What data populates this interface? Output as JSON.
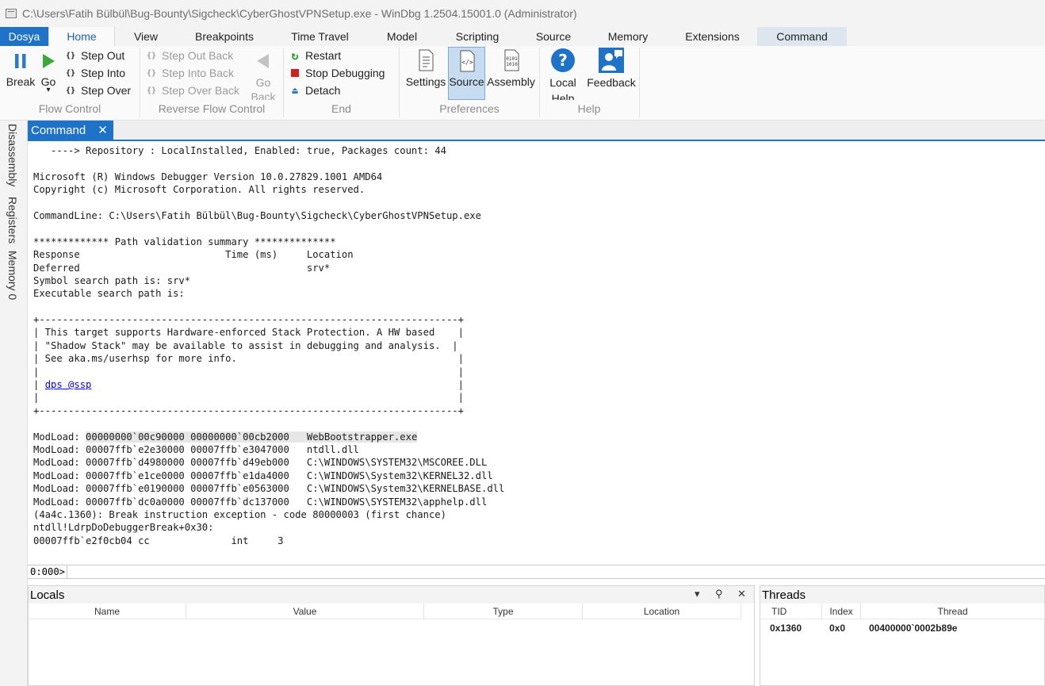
{
  "window": {
    "title": "C:\\Users\\Fatih Bülbül\\Bug-Bounty\\Sigcheck\\CyberGhostVPNSetup.exe  - WinDbg 1.2504.15001.0 (Administrator)"
  },
  "ribbon_tabs": [
    "Dosya",
    "Home",
    "View",
    "Breakpoints",
    "Time Travel",
    "Model",
    "Scripting",
    "Source",
    "Memory",
    "Extensions",
    "Command"
  ],
  "ribbon": {
    "flow_control": {
      "label": "Flow Control",
      "break": "Break",
      "go": "Go",
      "step_out": "Step Out",
      "step_into": "Step Into",
      "step_over": "Step Over"
    },
    "reverse_flow_control": {
      "label": "Reverse Flow Control",
      "step_out_back": "Step Out Back",
      "step_into_back": "Step Into Back",
      "step_over_back": "Step Over Back",
      "go_back": "Go Back"
    },
    "end": {
      "label": "End",
      "restart": "Restart",
      "stop_debugging": "Stop Debugging",
      "detach": "Detach"
    },
    "preferences": {
      "label": "Preferences",
      "settings": "Settings",
      "source": "Source",
      "assembly": "Assembly"
    },
    "help": {
      "label": "Help",
      "local_help": "Local Help",
      "feedback": "Feedback"
    }
  },
  "side_tabs": [
    "Disassembly",
    "Registers",
    "Memory 0"
  ],
  "command_pane": {
    "tab_label": "Command",
    "close_glyph": "✕",
    "lines": [
      "   ----> Repository : LocalInstalled, Enabled: true, Packages count: 44",
      "",
      "Microsoft (R) Windows Debugger Version 10.0.27829.1001 AMD64",
      "Copyright (c) Microsoft Corporation. All rights reserved.",
      "",
      "CommandLine: C:\\Users\\Fatih Bülbül\\Bug-Bounty\\Sigcheck\\CyberGhostVPNSetup.exe",
      "",
      "************* Path validation summary **************",
      "Response                         Time (ms)     Location",
      "Deferred                                       srv*",
      "Symbol search path is: srv*",
      "Executable search path is: ",
      "",
      "+------------------------------------------------------------------------+",
      "| This target supports Hardware-enforced Stack Protection. A HW based    |",
      "| \"Shadow Stack\" may be available to assist in debugging and analysis.  |",
      "| See aka.ms/userhsp for more info.                                      |",
      "|                                                                        |"
    ],
    "link_line_prefix": "| ",
    "link_text": "dps @ssp",
    "link_line_suffix": "                                                               |",
    "lines2": [
      "|                                                                        |",
      "+------------------------------------------------------------------------+",
      ""
    ],
    "modload_prefix": "ModLoad: ",
    "modload_highlight": "00000000`00c90000 00000000`00cb2000",
    "modload_rest": "   WebBootstrapper.exe",
    "lines3": [
      "ModLoad: 00007ffb`e2e30000 00007ffb`e3047000   ntdll.dll",
      "ModLoad: 00007ffb`d4980000 00007ffb`d49eb000   C:\\WINDOWS\\SYSTEM32\\MSCOREE.DLL",
      "ModLoad: 00007ffb`e1ce0000 00007ffb`e1da4000   C:\\WINDOWS\\System32\\KERNEL32.dll",
      "ModLoad: 00007ffb`e0190000 00007ffb`e0563000   C:\\WINDOWS\\System32\\KERNELBASE.dll",
      "ModLoad: 00007ffb`dc0a0000 00007ffb`dc137000   C:\\WINDOWS\\SYSTEM32\\apphelp.dll",
      "(4a4c.1360): Break instruction exception - code 80000003 (first chance)",
      "ntdll!LdrpDoDebuggerBreak+0x30:",
      "00007ffb`e2f0cb04 cc              int     3"
    ],
    "prompt": "0:000>",
    "input_value": ""
  },
  "locals": {
    "title": "Locals",
    "columns": [
      "Name",
      "Value",
      "Type",
      "Location"
    ],
    "dropdown_glyph": "▾",
    "pin_glyph": "⚲",
    "close_glyph": "✕"
  },
  "threads": {
    "title": "Threads",
    "columns": [
      "TID",
      "Index",
      "Thread"
    ],
    "rows": [
      {
        "tid": "0x1360",
        "index": "0x0",
        "thread": "00400000`0002b89e"
      }
    ]
  }
}
